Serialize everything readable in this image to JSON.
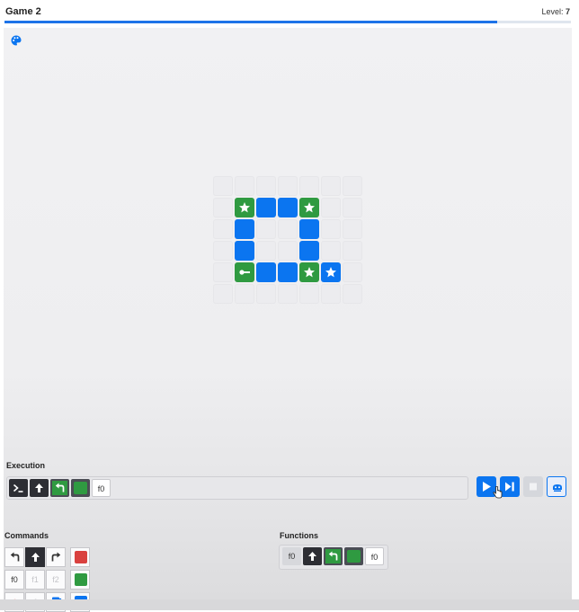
{
  "header": {
    "title": "Game 2",
    "level_label": "Level:",
    "level_value": "7",
    "progress_percent": 87
  },
  "board": {
    "rows": 6,
    "cols": 7,
    "cells": [
      {
        "row": 1,
        "col": 1,
        "color": "green",
        "icon": "star-icon"
      },
      {
        "row": 1,
        "col": 2,
        "color": "blue"
      },
      {
        "row": 1,
        "col": 3,
        "color": "blue"
      },
      {
        "row": 1,
        "col": 4,
        "color": "green",
        "icon": "star-icon"
      },
      {
        "row": 2,
        "col": 1,
        "color": "blue"
      },
      {
        "row": 2,
        "col": 4,
        "color": "blue"
      },
      {
        "row": 3,
        "col": 1,
        "color": "blue"
      },
      {
        "row": 3,
        "col": 4,
        "color": "blue"
      },
      {
        "row": 4,
        "col": 1,
        "color": "green",
        "icon": "robot-arrow-icon"
      },
      {
        "row": 4,
        "col": 2,
        "color": "blue"
      },
      {
        "row": 4,
        "col": 3,
        "color": "blue"
      },
      {
        "row": 4,
        "col": 4,
        "color": "green",
        "icon": "star-icon"
      },
      {
        "row": 4,
        "col": 5,
        "color": "blue",
        "icon": "star-icon"
      }
    ]
  },
  "execution": {
    "label": "Execution",
    "items": [
      "terminal-icon",
      "forward-arrow-icon",
      "turn-left-icon",
      "paint-green-icon",
      "f0"
    ],
    "f0_label": "f0"
  },
  "controls": [
    "play-button",
    "step-button",
    "stop-button",
    "robot-button"
  ],
  "commands": {
    "label": "Commands",
    "f0": "f0",
    "f1": "f1",
    "f2": "f2",
    "f3": "f",
    "f4": "f"
  },
  "functions": {
    "label": "Functions",
    "slot0": "f0",
    "slot4": "f0"
  },
  "colors": {
    "accent": "#0b75f0",
    "green": "#2f9a41",
    "red": "#d9413f",
    "dark": "#2d2e34"
  }
}
